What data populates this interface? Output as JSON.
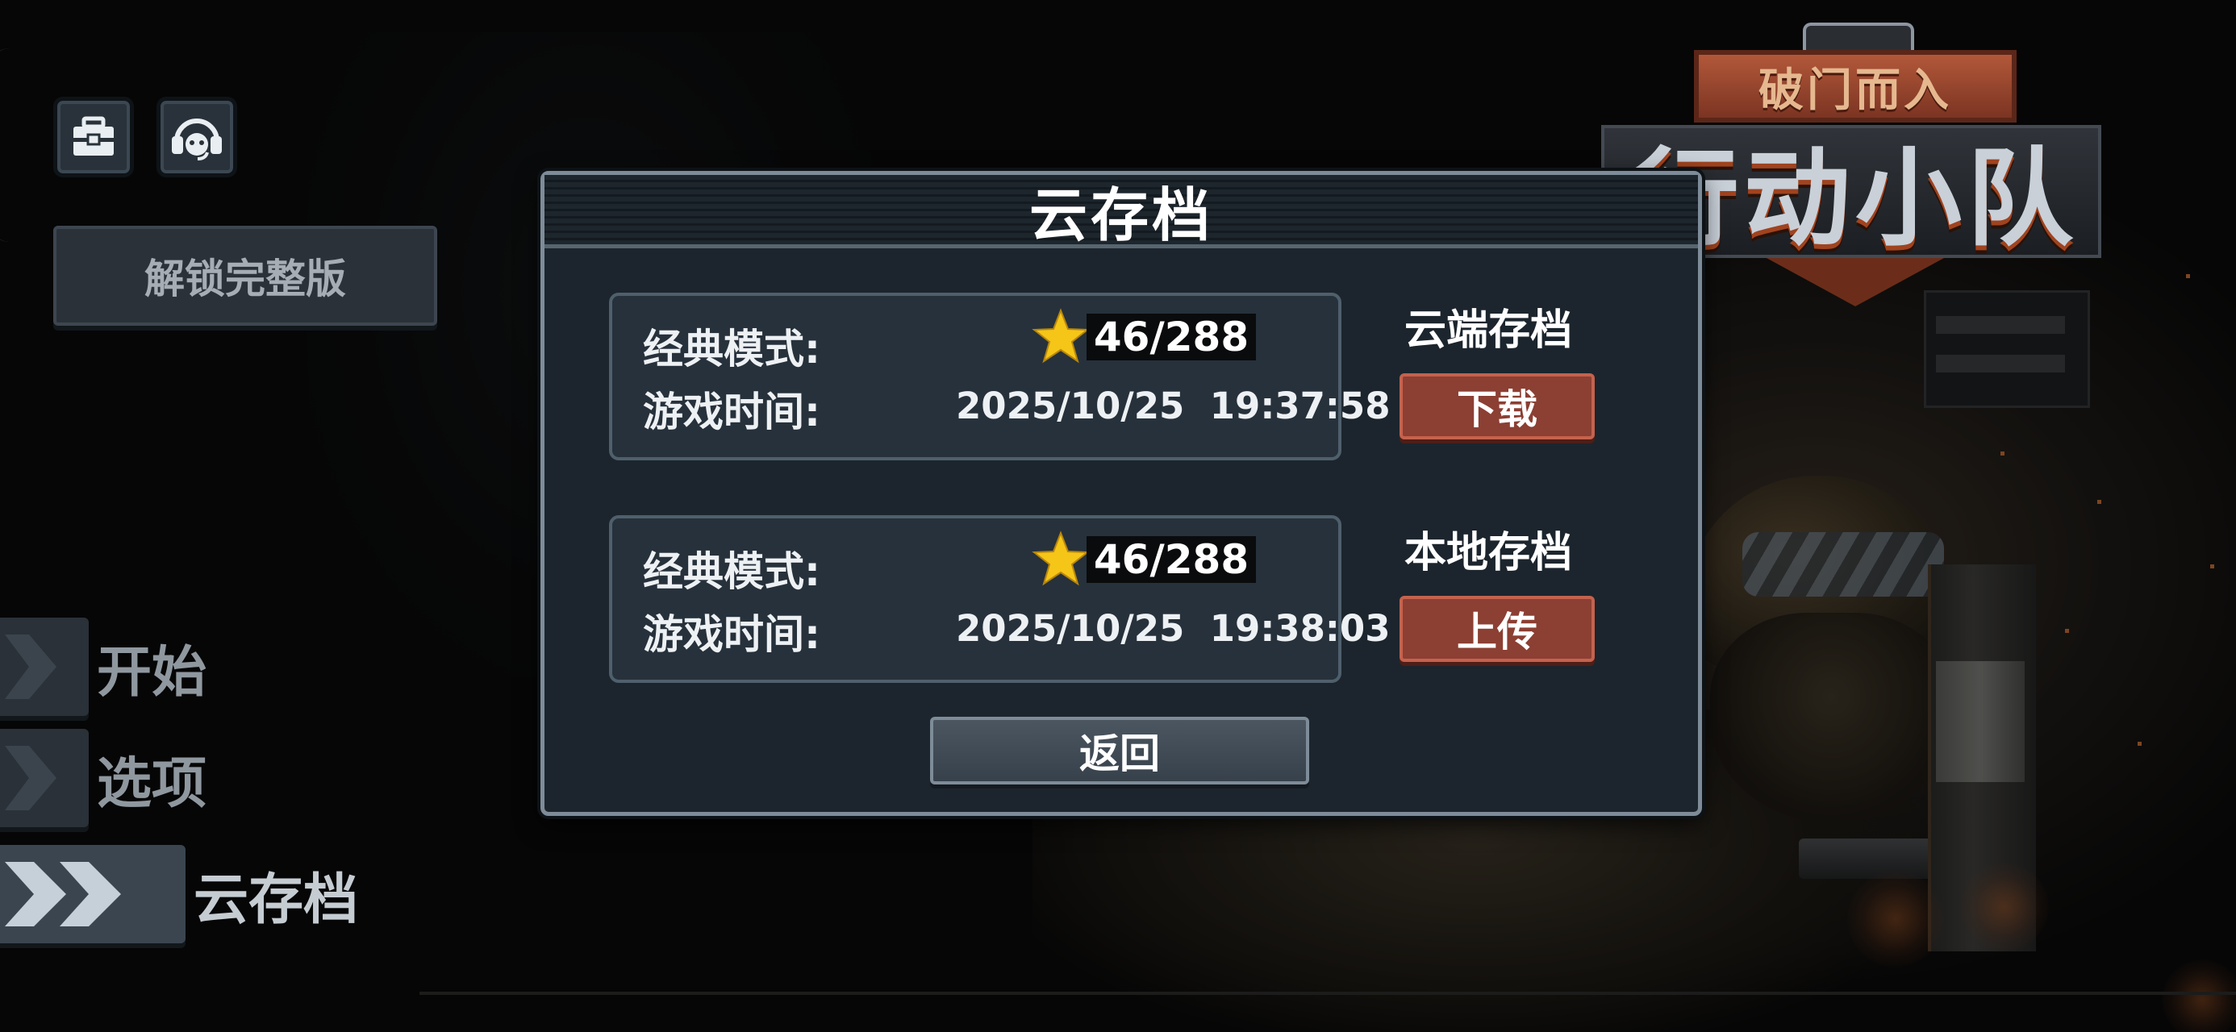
{
  "logo": {
    "subtitle": "破门而入",
    "title": "行动小队"
  },
  "top_icons": [
    {
      "icon": "briefcase-icon"
    },
    {
      "icon": "support-headset-icon"
    }
  ],
  "unlock_button": {
    "label": "解锁完整版"
  },
  "menu": {
    "items": [
      {
        "label": "开始"
      },
      {
        "label": "选项"
      },
      {
        "label": "云存档"
      }
    ]
  },
  "dialog": {
    "title": "云存档",
    "cloud": {
      "mode_label": "经典模式:",
      "stars": "46/288",
      "time_label": "游戏时间:",
      "time_value": "2025/10/25  19:37:58",
      "side_label": "云端存档",
      "button": "下载"
    },
    "local": {
      "mode_label": "经典模式:",
      "stars": "46/288",
      "time_label": "游戏时间:",
      "time_value": "2025/10/25  19:38:03",
      "side_label": "本地存档",
      "button": "上传"
    },
    "back_button": "返回"
  },
  "colors": {
    "accent_red": "#8c3f33",
    "star": "#f5c518",
    "dialog_bg": "#1c252d",
    "panel_border": "#7d8c98"
  }
}
